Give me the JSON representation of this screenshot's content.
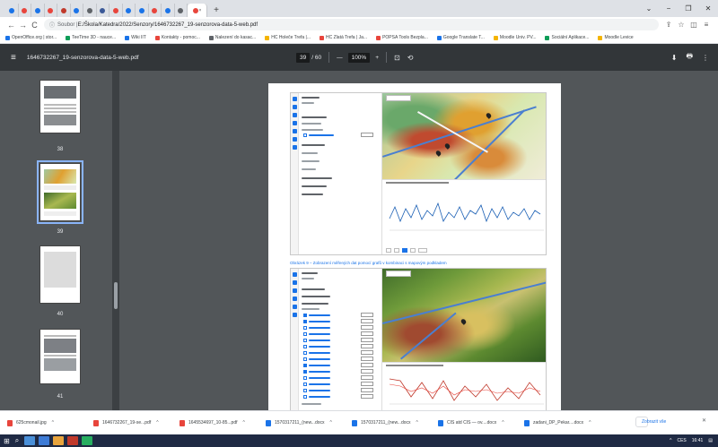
{
  "tabs": {
    "count_before_active": 14,
    "active_close": "×",
    "new_tab": "+",
    "colors": [
      "#1a73e8",
      "#e8453c",
      "#1a73e8",
      "#e8453c",
      "#c0392b",
      "#1a73e8",
      "#5f6368",
      "#3b5998",
      "#e8453c",
      "#1a73e8",
      "#1a73e8",
      "#e8453c",
      "#1a73e8",
      "#5f6368"
    ]
  },
  "window": {
    "minimize": "−",
    "restore": "❐",
    "close": "✕",
    "chevron": "⌄"
  },
  "toolbar": {
    "back": "←",
    "forward": "→",
    "reload": "C",
    "info": "ⓘ",
    "url_prefix": "Soubor | ",
    "url": "E:/Škola/Katedra/2022/Senzory/1646732267_19-senzorova-data-5-web.pdf",
    "share": "⇪",
    "star": "☆",
    "sidebar_toggle": "◫",
    "profile": "≡"
  },
  "bookmarks": [
    {
      "label": "OpenOffice.org | stor...",
      "color": "#1a73e8"
    },
    {
      "label": "TeeTime 3D - nauce...",
      "color": "#0f9d58"
    },
    {
      "label": "Wiki IIT",
      "color": "#1a73e8"
    },
    {
      "label": "Kontakty - pomoc...",
      "color": "#e8453c"
    },
    {
      "label": "Nalezení do kasac...",
      "color": "#5f6368"
    },
    {
      "label": "HC Holeče Trefa |...",
      "color": "#f4b400"
    },
    {
      "label": "HC Zlatá Trefa | Ja...",
      "color": "#e8453c"
    },
    {
      "label": "POPSA Tools Bezpla...",
      "color": "#e8453c"
    },
    {
      "label": "Google Translate T...",
      "color": "#1a73e8"
    },
    {
      "label": "Moodle Univ. PV...",
      "color": "#f4b400"
    },
    {
      "label": "Sociální Aplikace...",
      "color": "#0f9d58"
    },
    {
      "label": "Moodle Levice",
      "color": "#f4b400"
    }
  ],
  "pdf": {
    "menu_icon": "≡",
    "filename": "1646732267_19-senzorova-data-5-web.pdf",
    "current_page": "39",
    "total_pages": "/ 60",
    "zoom_out": "—",
    "zoom": "100%",
    "zoom_in": "+",
    "fit_icon": "⊡",
    "rotate_icon": "⟲",
    "download_icon": "⬇",
    "print_icon": "🖶",
    "more_icon": "⋮"
  },
  "thumbnails": [
    {
      "label": "38",
      "selected": false
    },
    {
      "label": "39",
      "selected": true
    },
    {
      "label": "40",
      "selected": false
    },
    {
      "label": "41",
      "selected": false
    }
  ],
  "page": {
    "caption": "Obrázek 9 – Zobrazení měřených dat pomocí grafů v kombinaci s mapovým podkladem"
  },
  "downloads": {
    "items": [
      {
        "label": "625cmonail.jpg",
        "color": "#e8453c"
      },
      {
        "label": "1646732267_19-se...pdf",
        "color": "#e8453c"
      },
      {
        "label": "1645534697_10-85...pdf",
        "color": "#e8453c"
      },
      {
        "label": "1570317211_(new...docx",
        "color": "#1a73e8"
      },
      {
        "label": "1570317211_(new...docx",
        "color": "#1a73e8"
      },
      {
        "label": "CIS atd CIS — ov....docx",
        "color": "#1a73e8"
      },
      {
        "label": "zadani_DP_Pekar....docx",
        "color": "#1a73e8"
      }
    ],
    "caret": "^",
    "show_all": "Zobrazit vše",
    "close": "✕"
  },
  "taskbar": {
    "start_icon": "⊞",
    "search_icon": "⌕",
    "tray_time": "16:41",
    "tray_lang": "CES",
    "tray_chevron": "^",
    "tray_notify": "▤"
  }
}
